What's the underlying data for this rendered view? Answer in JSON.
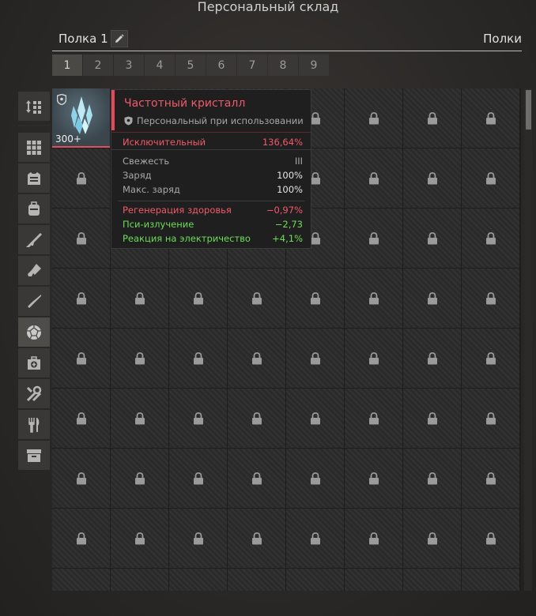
{
  "header": {
    "title": "Персональный склад"
  },
  "shelf": {
    "name": "Полка 1",
    "shelves_label": "Полки"
  },
  "tabs": [
    "1",
    "2",
    "3",
    "4",
    "5",
    "6",
    "7",
    "8",
    "9"
  ],
  "active_tab": "1",
  "sidebar": {
    "items": [
      "sort-icon",
      "grid-icon",
      "armor-icon",
      "backpack-icon",
      "rifle-icon",
      "pistol-icon",
      "knife-icon",
      "artifact-icon",
      "medkit-icon",
      "tools-icon",
      "food-icon",
      "box-icon"
    ],
    "active": "artifact-icon"
  },
  "inventory": {
    "item": {
      "count": "300+"
    }
  },
  "tooltip": {
    "name": "Частотный кристалл",
    "binding": "Персональный при использовании",
    "rarity_label": "Исключительный",
    "rarity_value": "136,64%",
    "stats": [
      {
        "label": "Свежесть",
        "value": "III"
      },
      {
        "label": "Заряд",
        "value": "100%"
      },
      {
        "label": "Макс. заряд",
        "value": "100%"
      }
    ],
    "effects": [
      {
        "label": "Регенерация здоровья",
        "value": "−0,97%",
        "tone": "red"
      },
      {
        "label": "Пси-излучение",
        "value": "−2,73",
        "tone": "green"
      },
      {
        "label": "Реакция на электричество",
        "value": "+4,1%",
        "tone": "green"
      }
    ]
  },
  "colors": {
    "accent": "#e8475a",
    "positive": "#6fdc5a",
    "background": "#2b2927"
  }
}
